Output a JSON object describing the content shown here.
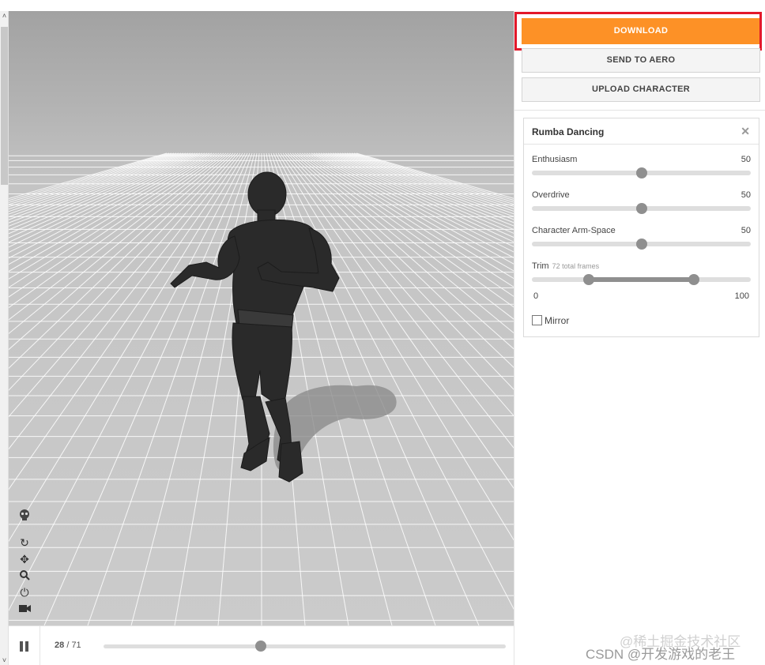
{
  "right_panel": {
    "download_label": "DOWNLOAD",
    "send_to_aero_label": "SEND TO AERO",
    "upload_character_label": "UPLOAD CHARACTER",
    "accent_color": "#fd9126",
    "highlight_color": "#e3182a"
  },
  "animation": {
    "title": "Rumba Dancing",
    "close_icon": "close-icon",
    "params": [
      {
        "label": "Enthusiasm",
        "value": "50"
      },
      {
        "label": "Overdrive",
        "value": "50"
      },
      {
        "label": "Character Arm-Space",
        "value": "50"
      }
    ],
    "trim": {
      "label": "Trim",
      "note": "72 total frames",
      "min_label": "0",
      "max_label": "100",
      "start_fraction": 0.26,
      "end_fraction": 0.74
    },
    "mirror_label": "Mirror",
    "mirror_checked": false
  },
  "viewport": {
    "tools": [
      "skeleton-icon",
      "reset-rotate-icon",
      "move-icon",
      "zoom-icon",
      "power-icon",
      "camera-icon"
    ],
    "character": "dark humanoid dancing figure"
  },
  "timeline": {
    "current_frame": "28",
    "total_frames": "71",
    "progress_fraction": 0.39
  },
  "watermark": {
    "line1": "@稀土掘金技术社区",
    "line2": "CSDN @开发游戏的老王"
  }
}
